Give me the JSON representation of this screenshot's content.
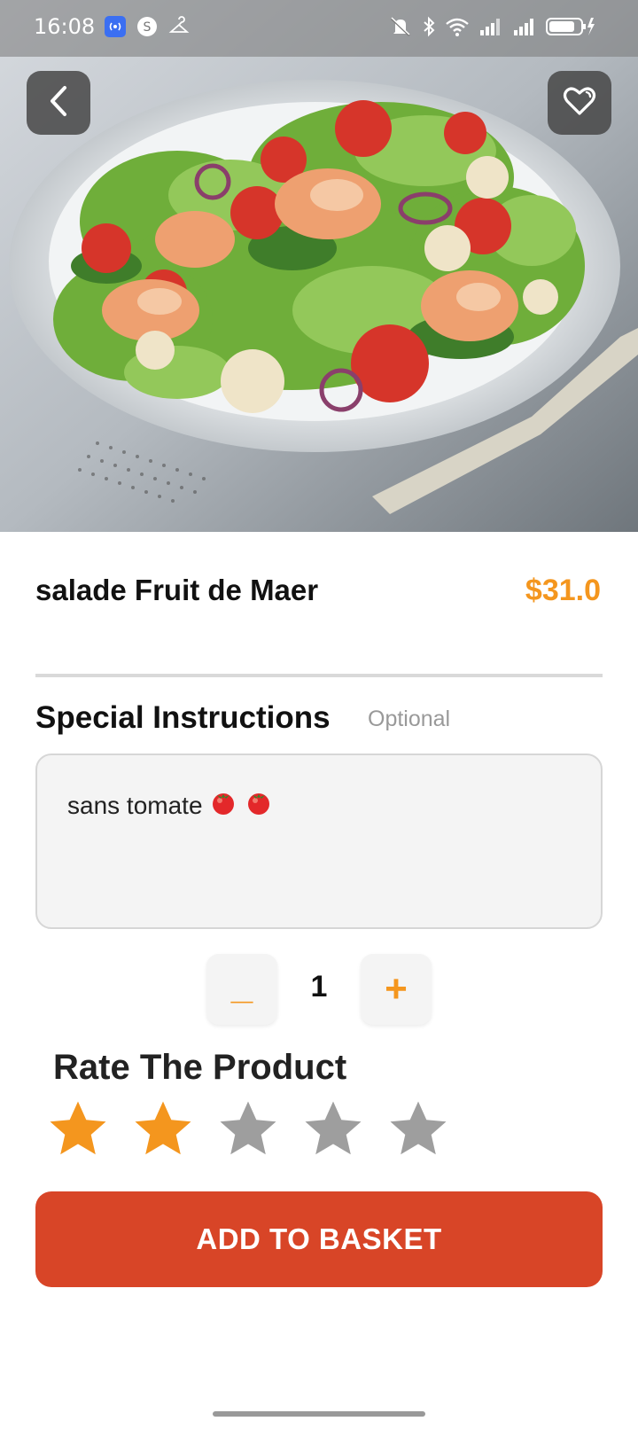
{
  "status_bar": {
    "time": "16:08"
  },
  "product": {
    "name": "salade Fruit de Maer",
    "price": "$31.0"
  },
  "instructions": {
    "title": "Special Instructions",
    "optional_label": "Optional",
    "value": "sans tomate"
  },
  "quantity": {
    "minus_label": "_",
    "value": "1",
    "plus_label": "+"
  },
  "rating": {
    "title": "Rate The Product",
    "value": 2,
    "max": 5
  },
  "add_button": {
    "label": "ADD TO BASKET"
  },
  "colors": {
    "accent": "#f4961e",
    "button": "#d84527",
    "star_active": "#f4961e",
    "star_inactive": "#9e9e9e"
  }
}
